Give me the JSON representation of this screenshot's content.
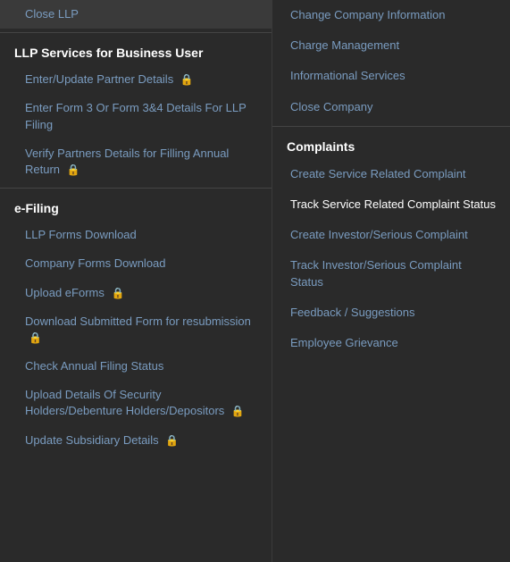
{
  "left_panel": {
    "close_llp": "Close LLP",
    "llp_section_header": "LLP Services for Business User",
    "llp_items": [
      {
        "label": "Enter/Update Partner Details",
        "lock": true
      },
      {
        "label": "Enter Form 3 Or Form 3&4 Details For LLP Filing",
        "lock": false
      },
      {
        "label": "Verify Partners Details for Filling Annual Return",
        "lock": true
      }
    ],
    "efiling_section_header": "e-Filing",
    "efiling_items": [
      {
        "label": "LLP Forms Download",
        "lock": false
      },
      {
        "label": "Company Forms Download",
        "lock": false
      },
      {
        "label": "Upload eForms",
        "lock": true
      },
      {
        "label": "Download Submitted Form for resubmission",
        "lock": true
      },
      {
        "label": "Check Annual Filing Status",
        "lock": false
      },
      {
        "label": "Upload Details Of Security Holders/Debenture Holders/Depositors",
        "lock": true
      },
      {
        "label": "Update Subsidiary Details",
        "lock": true
      }
    ]
  },
  "right_panel": {
    "top_items": [
      {
        "label": "Change Company Information"
      },
      {
        "label": "Charge Management"
      },
      {
        "label": "Informational Services"
      },
      {
        "label": "Close Company"
      }
    ],
    "complaints_header": "Complaints",
    "complaints_items": [
      {
        "label": "Create Service Related Complaint"
      },
      {
        "label": "Track Service Related Complaint Status",
        "active": true
      },
      {
        "label": "Create Investor/Serious Complaint"
      },
      {
        "label": "Track Investor/Serious Complaint Status"
      },
      {
        "label": "Feedback / Suggestions"
      },
      {
        "label": "Employee Grievance"
      }
    ]
  },
  "icons": {
    "lock": "🔒"
  }
}
